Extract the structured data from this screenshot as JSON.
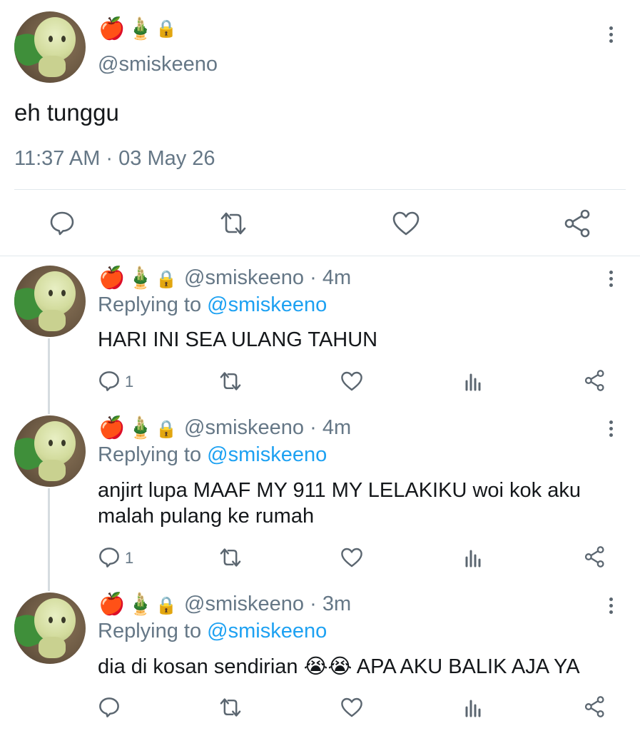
{
  "main_tweet": {
    "display_name_emojis": [
      "🍎",
      "🎍",
      "🔒"
    ],
    "handle": "@smiskeeno",
    "text": "eh tunggu",
    "timestamp": "11:37 AM · 03 May 26",
    "actions": [
      "reply-icon",
      "retweet-icon",
      "like-icon",
      "share-icon"
    ]
  },
  "replies": [
    {
      "display_name_emojis": [
        "🍎",
        "🎍",
        "🔒"
      ],
      "handle": "@smiskeeno",
      "time": "· 4m",
      "replying_prefix": "Replying to",
      "replying_handle": "@smiskeeno",
      "text_lines": [
        "HARI INI SEA ULANG TAHUN"
      ],
      "reply_count": "1"
    },
    {
      "display_name_emojis": [
        "🍎",
        "🎍",
        "🔒"
      ],
      "handle": "@smiskeeno",
      "time": "· 4m",
      "replying_prefix": "Replying to",
      "replying_handle": "@smiskeeno",
      "text_lines": [
        "anjirt lupa MAAF MY 911 MY LELAKIKU woi kok aku",
        "malah pulang ke rumah"
      ],
      "reply_count": "1"
    },
    {
      "display_name_emojis": [
        "🍎",
        "🎍",
        "🔒"
      ],
      "handle": "@smiskeeno",
      "time": "· 3m",
      "replying_prefix": "Replying to",
      "replying_handle": "@smiskeeno",
      "text_lines": [
        "dia di kosan sendirian 😭😭 APA AKU BALIK AJA YA"
      ],
      "reply_count": ""
    }
  ],
  "colors": {
    "text": "#14171a",
    "muted": "#657786",
    "link": "#1da1f2",
    "divider": "#e1e8ed"
  }
}
